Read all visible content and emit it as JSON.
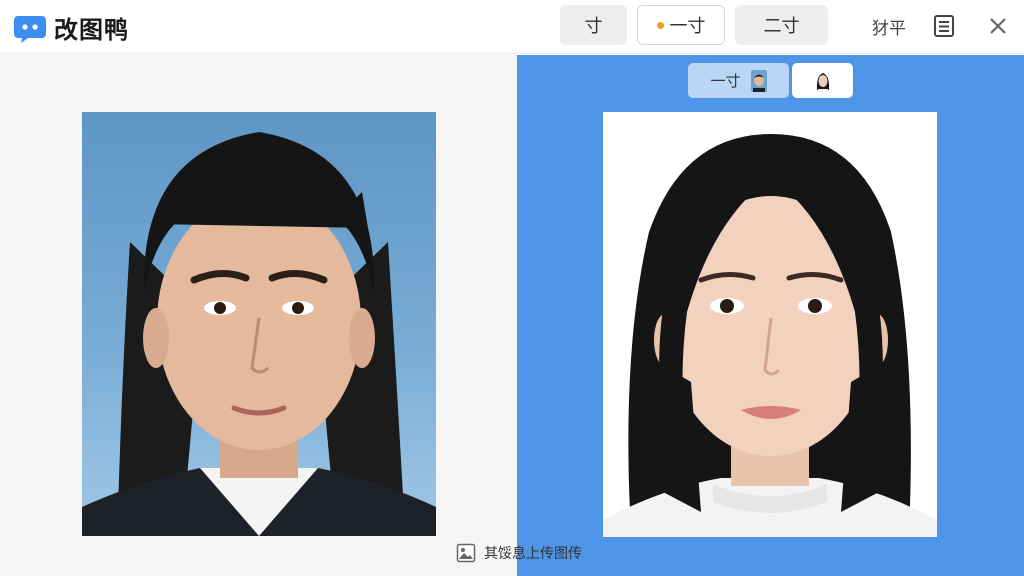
{
  "app": {
    "name": "改图鸭"
  },
  "size_options": [
    {
      "label": "寸"
    },
    {
      "label": "一寸"
    },
    {
      "label": "二寸"
    }
  ],
  "header": {
    "text_action": "犲平"
  },
  "preview_tabs": [
    {
      "label": "一寸"
    }
  ],
  "upload": {
    "hint": "其馁息上传图传"
  },
  "colors": {
    "accent_blue": "#4e95e8",
    "selected_dot": "#f59a23",
    "tab_active": "#b9d6f6"
  }
}
